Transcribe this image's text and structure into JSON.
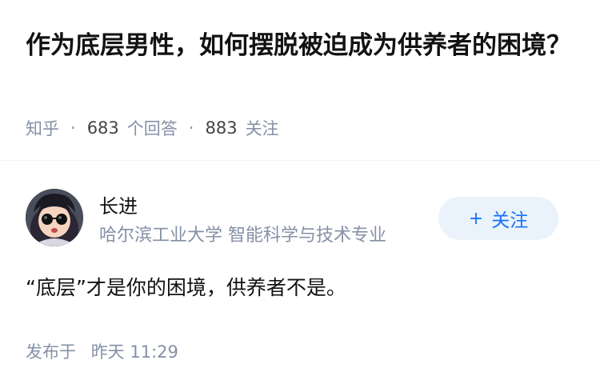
{
  "question": {
    "title": "作为底层男性，如何摆脱被迫成为供养者的困境？",
    "source": "知乎",
    "answers_count": "683",
    "answers_label": "个回答",
    "followers_count": "883",
    "followers_label": "关注"
  },
  "author": {
    "name": "长进",
    "bio": "哈尔滨工业大学 智能科学与技术专业",
    "avatar_icon": "avatar-icon"
  },
  "follow_button": {
    "plus": "+",
    "label": "关注"
  },
  "answer": {
    "text": "“底层”才是你的困境，供养者不是。"
  },
  "publish": {
    "label": "发布于",
    "time": "昨天 11:29"
  },
  "colors": {
    "accent": "#1772f6",
    "accent_bg": "#eaf2fb",
    "meta_text": "#8590a6"
  }
}
